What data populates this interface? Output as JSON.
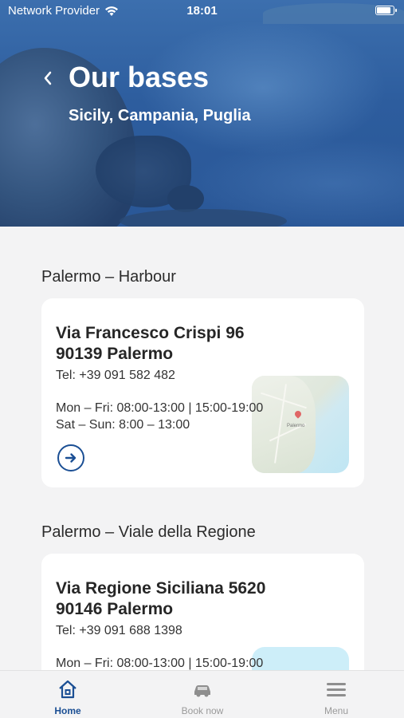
{
  "status": {
    "carrier": "Network Provider",
    "time": "18:01",
    "battery_level": 0.95
  },
  "header": {
    "title": "Our bases",
    "subtitle": "Sicily, Campania, Puglia"
  },
  "bases": [
    {
      "name": "Palermo – Harbour",
      "address_line1": "Via Francesco Crispi 96",
      "address_line2": "90139 Palermo",
      "tel": "Tel: +39 091 582 482",
      "hours_weekday": "Mon – Fri: 08:00-13:00 | 15:00-19:00",
      "hours_weekend": "Sat – Sun: 8:00 – 13:00",
      "map_city_label": "Palermo"
    },
    {
      "name": "Palermo – Viale della Regione",
      "address_line1": "Via Regione Siciliana 5620",
      "address_line2": "90146 Palermo",
      "tel": "Tel: +39 091 688 1398",
      "hours_weekday": "Mon – Fri: 08:00-13:00 | 15:00-19:00"
    }
  ],
  "tabs": [
    {
      "label": "Home",
      "icon": "home-icon",
      "active": true
    },
    {
      "label": "Book now",
      "icon": "car-icon",
      "active": false
    },
    {
      "label": "Menu",
      "icon": "hamburger-icon",
      "active": false
    }
  ],
  "colors": {
    "accent": "#1b4f94",
    "background": "#f3f3f4",
    "card": "#ffffff"
  }
}
